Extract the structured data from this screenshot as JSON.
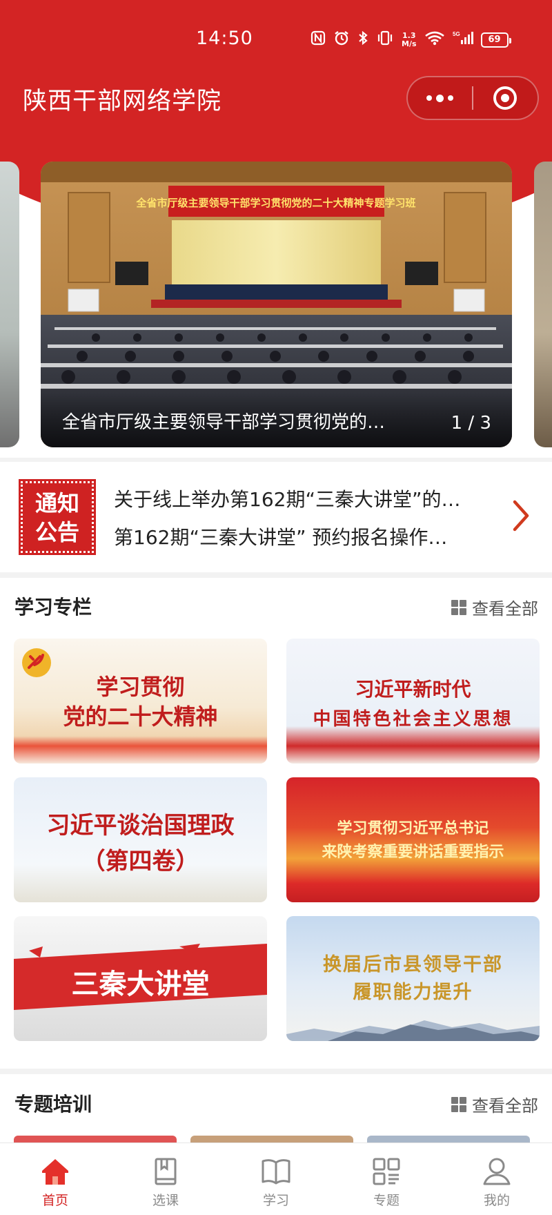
{
  "status_bar": {
    "time": "14:50",
    "net_speed": "1.3\nM/s",
    "network": "5G",
    "battery": "69"
  },
  "header": {
    "title": "陕西干部网络学院"
  },
  "carousel": {
    "slide_banner_text": "全省市厅级主要领导干部学习贯彻党的二十大精神专题学习班",
    "caption": "全省市厅级主要领导干部学习贯彻党的…",
    "counter": "1 / 3"
  },
  "notice": {
    "badge": "通知\n公告",
    "items": [
      "关于线上举办第162期“三秦大讲堂”的…",
      "第162期“三秦大讲堂” 预约报名操作…"
    ]
  },
  "study_column": {
    "title": "学习专栏",
    "view_all": "查看全部",
    "cards": [
      {
        "line1": "学习贯彻",
        "line2": "党的二十大精神"
      },
      {
        "line1": "习近平新时代",
        "line2": "中国特色社会主义思想"
      },
      {
        "line1": "习近平谈治国理政",
        "line2": "（第四卷）"
      },
      {
        "line1": "学习贯彻习近平总书记",
        "line2": "来陕考察重要讲话重要指示"
      },
      {
        "line1": "三秦大讲堂",
        "line2": ""
      },
      {
        "line1": "换届后市县领导干部",
        "line2": "履职能力提升"
      }
    ]
  },
  "training": {
    "title": "专题培训",
    "view_all": "查看全部"
  },
  "tabbar": {
    "tabs": [
      {
        "label": "首页",
        "icon": "home-icon",
        "active": true
      },
      {
        "label": "选课",
        "icon": "book-select-icon",
        "active": false
      },
      {
        "label": "学习",
        "icon": "open-book-icon",
        "active": false
      },
      {
        "label": "专题",
        "icon": "topics-grid-icon",
        "active": false
      },
      {
        "label": "我的",
        "icon": "user-icon",
        "active": false
      }
    ]
  },
  "colors": {
    "brand_red": "#d32424",
    "text": "#222222",
    "muted": "#8a8a8a"
  }
}
